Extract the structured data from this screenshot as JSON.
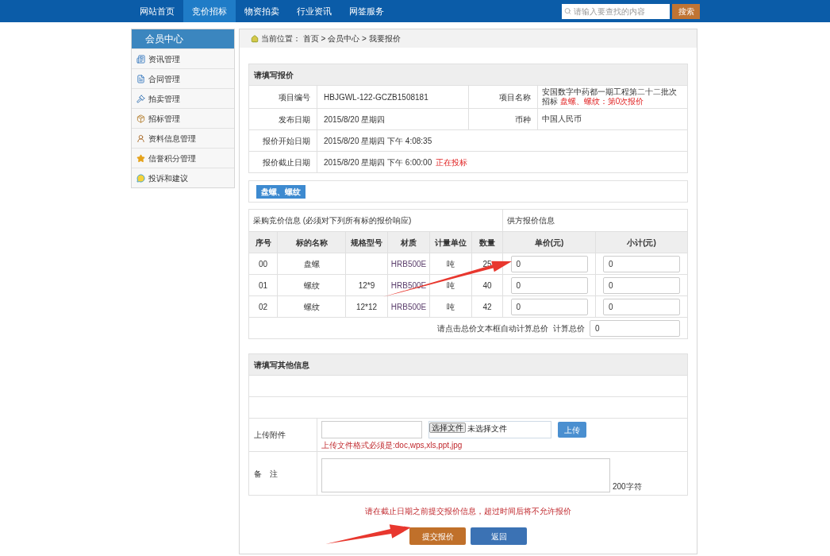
{
  "nav": {
    "items": [
      {
        "label": "网站首页",
        "selected": false
      },
      {
        "label": "竞价招标",
        "selected": true
      },
      {
        "label": "物资拍卖",
        "selected": false
      },
      {
        "label": "行业资讯",
        "selected": false
      },
      {
        "label": "网签服务",
        "selected": false
      }
    ],
    "search": {
      "placeholder": "请输入要查找的内容"
    },
    "search_button": "搜索"
  },
  "sidebar": {
    "title": "会员中心",
    "items": [
      {
        "label": "资讯管理"
      },
      {
        "label": "合同管理"
      },
      {
        "label": "拍卖管理"
      },
      {
        "label": "招标管理"
      },
      {
        "label": "资料信息管理"
      },
      {
        "label": "信誉积分管理"
      },
      {
        "label": "投诉和建议"
      }
    ]
  },
  "breadcrumb": "当前位置： 首页 > 会员中心 > 我要报价",
  "quote_info": {
    "title": "请填写报价",
    "rows": [
      {
        "label": "项目编号",
        "value": "HBJGWL-122-GCZB1508181",
        "label2": "项目名称",
        "value2": "安国数字中药都一期工程第二十二批次招标",
        "value2_note": "盘螺、螺纹：第0次报价"
      },
      {
        "label": "发布日期",
        "value": "2015/8/20 星期四",
        "label2": "币种",
        "value2": "中国人民币"
      },
      {
        "label": "报价开始日期",
        "value": "2015/8/20 星期四 下午 4:08:35"
      },
      {
        "label": "报价截止日期",
        "value": "2015/8/20 星期四 下午 6:00:00",
        "status": "正在投标"
      }
    ]
  },
  "items": {
    "tab": "盘螺、螺纹",
    "caption_left": "采购竞价信息 (必须对下列所有标的报价响应)",
    "caption_right": "供方报价信息",
    "columns": [
      "序号",
      "标的名称",
      "规格型号",
      "材质",
      "计量单位",
      "数量",
      "单价(元)",
      "小计(元)"
    ],
    "rows": [
      {
        "no": "00",
        "name": "盘螺",
        "material": "HRB500E",
        "unit": "吨",
        "qty": "25",
        "unit_price": "0",
        "subtotal": "0"
      },
      {
        "no": "01",
        "name": "螺纹",
        "spec": "12*9",
        "material": "HRB500E",
        "unit": "吨",
        "qty": "40",
        "unit_price": "0",
        "subtotal": "0"
      },
      {
        "no": "02",
        "name": "螺纹",
        "spec": "12*12",
        "material": "HRB500E",
        "unit": "吨",
        "qty": "42",
        "unit_price": "0",
        "subtotal": "0"
      }
    ],
    "total_hint": "请点击总价文本框自动计算总价",
    "total_label": "计算总价",
    "total_value": "0"
  },
  "other": {
    "title": "请填写其他信息",
    "upload": {
      "label": "上传附件",
      "file_button": "选择文件",
      "file_status": "未选择文件",
      "upload_button": "上传",
      "hint": "上传文件格式必须是:doc,wps,xls,ppt,jpg"
    },
    "notes": {
      "label": "备　注",
      "counter": "200字符"
    }
  },
  "warning": "请在截止日期之前提交报价信息，超过时间后将不允许报价",
  "buttons": {
    "submit": "提交报价",
    "back": "返回"
  }
}
